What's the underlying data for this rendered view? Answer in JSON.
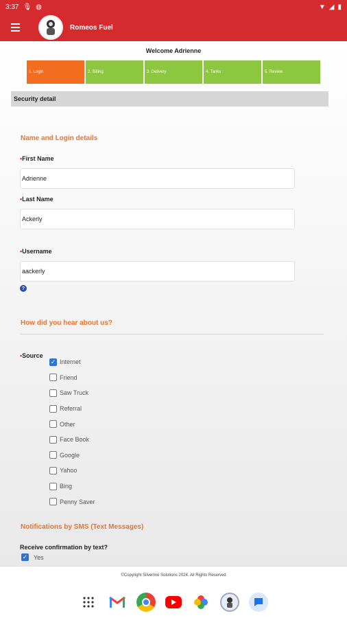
{
  "status": {
    "time": "3:37"
  },
  "app": {
    "title": "Romeos Fuel"
  },
  "welcome": "Welcome Adrienne",
  "steps": [
    "1. Login",
    "2. Billing",
    "3. Delivery",
    "4. Tanks",
    "5. Review"
  ],
  "active_step": 0,
  "section_title": "Security detail",
  "name_heading": "Name and Login details",
  "fields": {
    "first_name": {
      "label": "First Name",
      "value": "Adrienne"
    },
    "last_name": {
      "label": "Last Name",
      "value": "Ackerly"
    },
    "username": {
      "label": "Username",
      "value": "aackerly"
    }
  },
  "help_glyph": "?",
  "hear_heading": "How did you hear about us?",
  "source": {
    "label": "Source",
    "options": [
      {
        "label": "Internet",
        "checked": true
      },
      {
        "label": "Friend",
        "checked": false
      },
      {
        "label": "Saw Truck",
        "checked": false
      },
      {
        "label": "Referral",
        "checked": false
      },
      {
        "label": "Other",
        "checked": false
      },
      {
        "label": "Face Book",
        "checked": false
      },
      {
        "label": "Google",
        "checked": false
      },
      {
        "label": "Yahoo",
        "checked": false
      },
      {
        "label": "Bing",
        "checked": false
      },
      {
        "label": "Penny Saver",
        "checked": false
      }
    ]
  },
  "sms": {
    "heading": "Notifications by SMS (Text Messages)",
    "question": "Receive confirmation by text?",
    "yes_label": "Yes",
    "yes_checked": true
  },
  "footer": "©Copyright Silverline Solutions 2024. All Rights Reserved",
  "colors": {
    "brand_red": "#d52b2e",
    "step_active": "#f26d1f",
    "step_done": "#8dc63f",
    "heading_orange": "#e8742f"
  },
  "dock": [
    "apps-grid-icon",
    "gmail-icon",
    "chrome-icon",
    "youtube-icon",
    "photos-icon",
    "romeos-app-icon",
    "messages-icon"
  ]
}
